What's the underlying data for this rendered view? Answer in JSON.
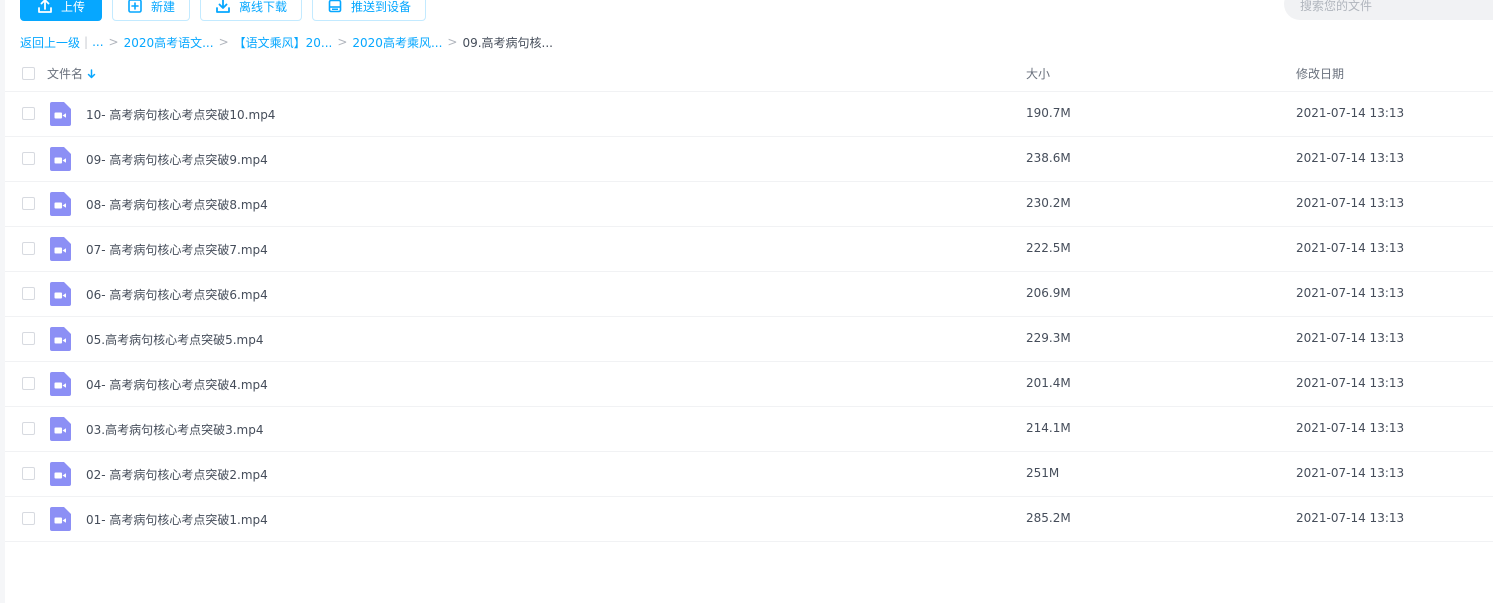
{
  "toolbar": {
    "upload_label": "上传",
    "new_label": "新建",
    "offline_download_label": "离线下载",
    "push_to_device_label": "推送到设备"
  },
  "search": {
    "placeholder": "搜索您的文件"
  },
  "breadcrumb": {
    "back_label": "返回上一级",
    "ellipsis": "...",
    "items": [
      "2020高考语文...",
      "【语文乘风】20...",
      "2020高考乘风..."
    ],
    "current": "09.高考病句核..."
  },
  "table": {
    "headers": {
      "name": "文件名",
      "size": "大小",
      "modified": "修改日期"
    },
    "rows": [
      {
        "name": "10- 高考病句核心考点突破10.mp4",
        "size": "190.7M",
        "modified": "2021-07-14 13:13"
      },
      {
        "name": "09- 高考病句核心考点突破9.mp4",
        "size": "238.6M",
        "modified": "2021-07-14 13:13"
      },
      {
        "name": "08- 高考病句核心考点突破8.mp4",
        "size": "230.2M",
        "modified": "2021-07-14 13:13"
      },
      {
        "name": "07- 高考病句核心考点突破7.mp4",
        "size": "222.5M",
        "modified": "2021-07-14 13:13"
      },
      {
        "name": "06- 高考病句核心考点突破6.mp4",
        "size": "206.9M",
        "modified": "2021-07-14 13:13"
      },
      {
        "name": "05.高考病句核心考点突破5.mp4",
        "size": "229.3M",
        "modified": "2021-07-14 13:13"
      },
      {
        "name": "04- 高考病句核心考点突破4.mp4",
        "size": "201.4M",
        "modified": "2021-07-14 13:13"
      },
      {
        "name": "03.高考病句核心考点突破3.mp4",
        "size": "214.1M",
        "modified": "2021-07-14 13:13"
      },
      {
        "name": "02- 高考病句核心考点突破2.mp4",
        "size": "251M",
        "modified": "2021-07-14 13:13"
      },
      {
        "name": "01- 高考病句核心考点突破1.mp4",
        "size": "285.2M",
        "modified": "2021-07-14 13:13"
      }
    ]
  },
  "colors": {
    "accent": "#06a7ff",
    "video_icon": "#8c8ff5",
    "text": "#454d5a",
    "muted": "#6a717d"
  },
  "icons": {
    "upload": "upload-icon",
    "new": "new-folder-icon",
    "offline_download": "download-icon",
    "push": "device-icon",
    "sort": "arrow-down-icon",
    "file": "video-file-icon"
  }
}
